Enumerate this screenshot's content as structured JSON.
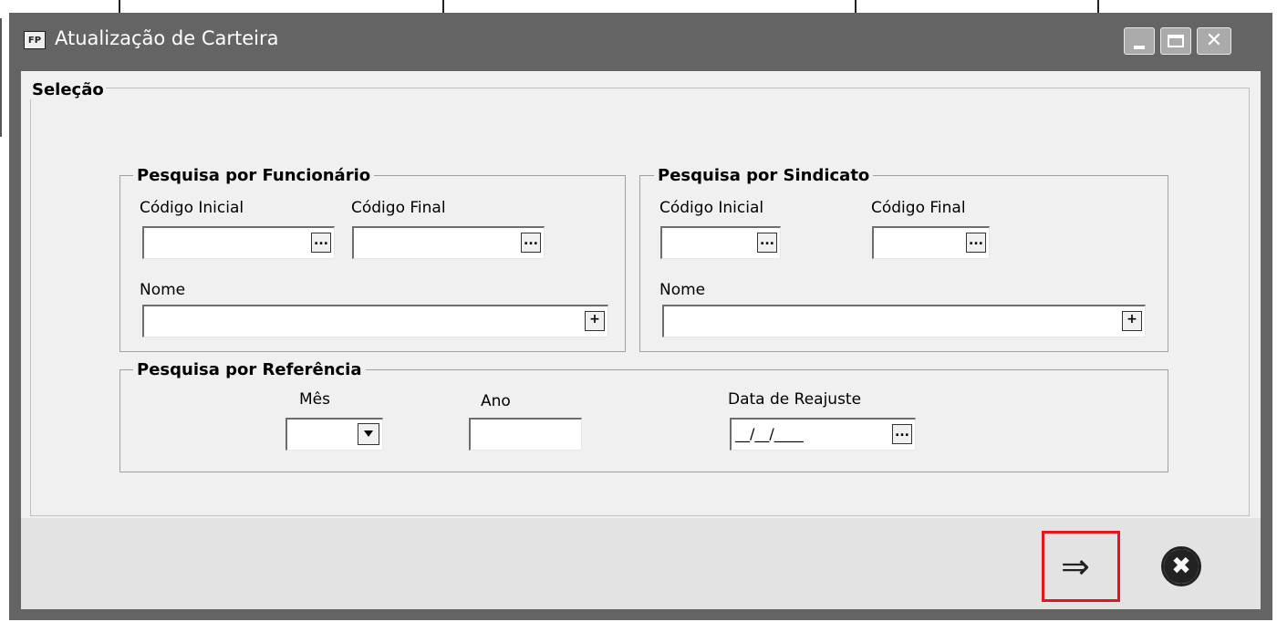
{
  "window": {
    "title": "Atualização de Carteira",
    "app_icon_text": "FP"
  },
  "selection": {
    "legend": "Seleção",
    "funcionario": {
      "legend": "Pesquisa por Funcionário",
      "codigo_inicial_label": "Código Inicial",
      "codigo_final_label": "Código Final",
      "nome_label": "Nome",
      "codigo_inicial_value": "",
      "codigo_final_value": "",
      "nome_value": ""
    },
    "sindicato": {
      "legend": "Pesquisa por Sindicato",
      "codigo_inicial_label": "Código Inicial",
      "codigo_final_label": "Código Final",
      "nome_label": "Nome",
      "codigo_inicial_value": "",
      "codigo_final_value": "",
      "nome_value": ""
    },
    "referencia": {
      "legend": "Pesquisa por Referência",
      "mes_label": "Mês",
      "ano_label": "Ano",
      "data_reajuste_label": "Data de Reajuste",
      "mes_value": "",
      "ano_value": "",
      "data_reajuste_mask": "__/__/____"
    }
  },
  "buttons": {
    "ellipsis": "...",
    "plus": "+",
    "next_icon": "arrow-right-icon",
    "close_icon": "close-circle-icon"
  },
  "colors": {
    "titlebar": "#646464",
    "client_bg": "#f0f0f0",
    "highlight": "#e8131b"
  }
}
